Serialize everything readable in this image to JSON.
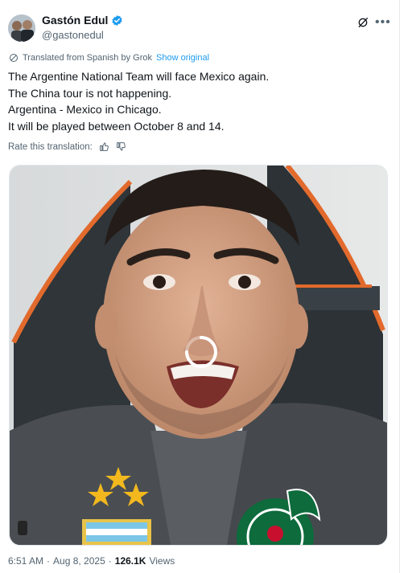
{
  "author": {
    "name": "Gastón Edul",
    "handle": "@gastonedul"
  },
  "translation": {
    "note": "Translated from Spanish by Grok",
    "show_original": "Show original"
  },
  "tweet": {
    "lines": [
      "The Argentine National Team will face Mexico again.",
      "The China tour is not happening.",
      "Argentina - Mexico in Chicago.",
      "It will be played between October 8 and 14."
    ]
  },
  "rate": {
    "label": "Rate this translation:"
  },
  "meta": {
    "time": "6:51 AM",
    "dot1": "·",
    "date": "Aug 8, 2025",
    "dot2": "·",
    "views_count": "126.1K",
    "views_label": "Views"
  },
  "colors": {
    "link": "#1d9bf0",
    "verified": "#1d9bf0",
    "secondary_text": "#536471"
  },
  "icons": [
    "verified-badge-icon",
    "grok-icon",
    "more-icon",
    "translate-icon",
    "thumbs-up-icon",
    "thumbs-down-icon",
    "loading-spinner-icon",
    "mute-icon"
  ]
}
